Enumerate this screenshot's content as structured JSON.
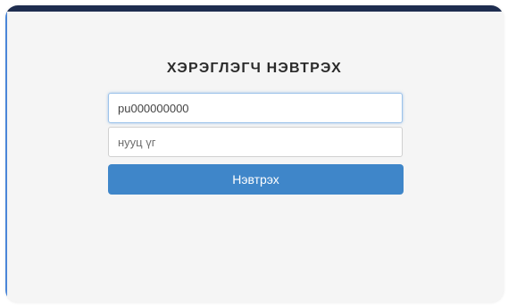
{
  "login": {
    "title": "ХЭРЭГЛЭГЧ НЭВТРЭХ",
    "username": {
      "value": "pu000000000",
      "placeholder": ""
    },
    "password": {
      "value": "",
      "placeholder": "нууц үг"
    },
    "submit_label": "Нэвтрэх"
  },
  "colors": {
    "header_bar": "#1e2d4f",
    "button": "#3f86c9",
    "card_background": "#f5f5f5"
  }
}
